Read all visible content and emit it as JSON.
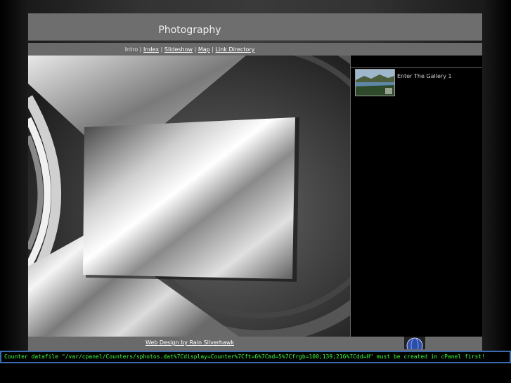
{
  "header": {
    "title": "Photography"
  },
  "nav": {
    "items": [
      {
        "label": "Intro",
        "link": false
      },
      {
        "label": "Index",
        "link": true
      },
      {
        "label": "Slideshow",
        "link": true
      },
      {
        "label": "Map",
        "link": true
      },
      {
        "label": "Link Directory",
        "link": true
      }
    ],
    "separator": "|"
  },
  "gallery": {
    "label": "Enter The Gallery 1"
  },
  "footer": {
    "credit": "Web Design by Rain Silverhawk"
  },
  "counter_error": "Counter datafile \"/var/cpanel/Counters/sphotos.dat%7Cdisplay=Counter%7Cft=6%7Cmd=5%7Cfrgb=100;139;216%7Cdd=H\" must be created in cPanel first!",
  "colors": {
    "panel": "#6e6e6e",
    "content_bg": "#000000",
    "error_text": "#3cff3c",
    "error_border": "#3a6bb0"
  }
}
